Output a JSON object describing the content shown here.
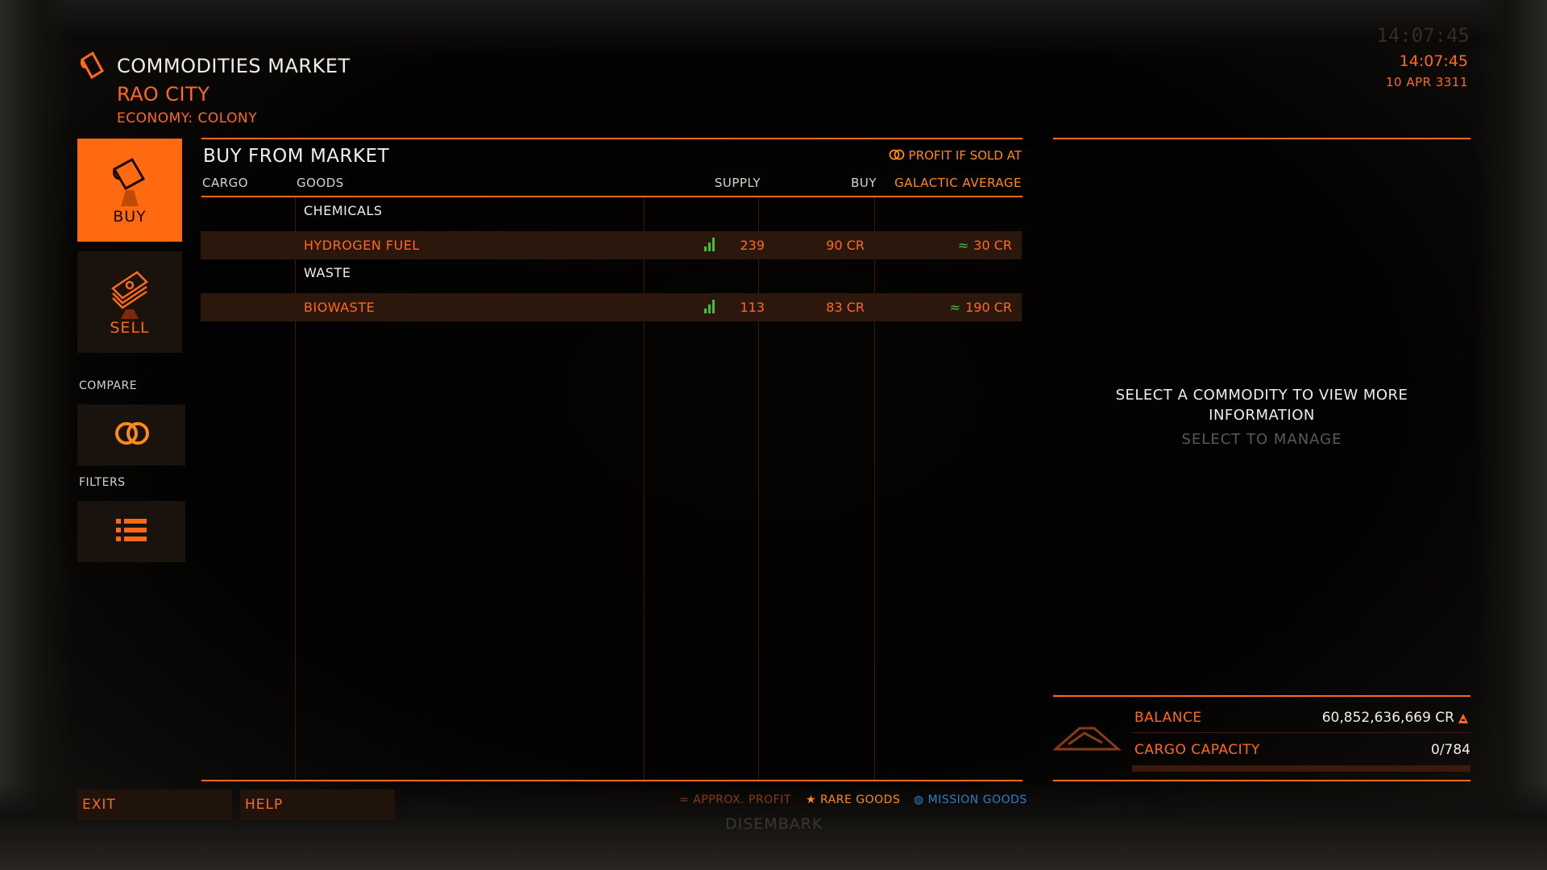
{
  "header": {
    "title": "COMMODITIES MARKET",
    "station": "RAO CITY",
    "economy": "ECONOMY: COLONY"
  },
  "clock": {
    "time_ghost": "14:07:45",
    "time": "14:07:45",
    "date": "10 APR 3311"
  },
  "sidebar": {
    "buy_label": "BUY",
    "sell_label": "SELL",
    "compare_label": "COMPARE",
    "filters_label": "FILTERS",
    "buy_icon": "cargo-canister-icon",
    "sell_icon": "credit-notes-icon",
    "compare_icon": "compare-rings-icon",
    "filters_icon": "list-icon"
  },
  "market": {
    "title": "BUY FROM MARKET",
    "profit_label": "PROFIT IF SOLD AT",
    "columns": {
      "cargo": "CARGO",
      "goods": "GOODS",
      "supply": "SUPPLY",
      "buy": "BUY",
      "galactic_average": "GALACTIC AVERAGE"
    },
    "groups": [
      {
        "name": "CHEMICALS",
        "items": [
          {
            "name": "HYDROGEN FUEL",
            "supply": "239",
            "buy": "90 CR",
            "avg_symbol": "≈",
            "galactic_average": "30 CR"
          }
        ]
      },
      {
        "name": "WASTE",
        "items": [
          {
            "name": "BIOWASTE",
            "supply": "113",
            "buy": "83 CR",
            "avg_symbol": "≈",
            "galactic_average": "190 CR"
          }
        ]
      }
    ]
  },
  "legend": {
    "approx_profit": "APPROX. PROFIT",
    "rare_goods": "RARE GOODS",
    "mission_goods": "MISSION GOODS"
  },
  "bottom": {
    "exit_label": "EXIT",
    "help_label": "HELP",
    "disembark": "DISEMBARK"
  },
  "detail": {
    "message": "SELECT A COMMODITY TO VIEW MORE INFORMATION",
    "sub": "SELECT TO MANAGE"
  },
  "status": {
    "balance_label": "BALANCE",
    "balance_value": "60,852,636,669 CR",
    "cargo_label": "CARGO CAPACITY",
    "cargo_value": "0/784",
    "cargo_fraction": 0
  },
  "colors": {
    "accent": "#ff6a1a",
    "text": "#f2ede8",
    "supply_good": "#3ec23e",
    "mission": "#2a7fc7"
  }
}
